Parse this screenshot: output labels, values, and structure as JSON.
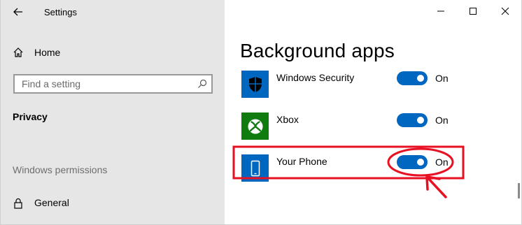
{
  "window": {
    "title": "Settings"
  },
  "sidebar": {
    "home_label": "Home",
    "search_placeholder": "Find a setting",
    "section_privacy": "Privacy",
    "section_permissions": "Windows permissions",
    "general_label": "General"
  },
  "main": {
    "title": "Background apps",
    "apps": [
      {
        "name": "Windows Security",
        "toggle": "On",
        "icon": "shield-icon",
        "icon_bg": "#0067c0"
      },
      {
        "name": "Xbox",
        "toggle": "On",
        "icon": "xbox-icon",
        "icon_bg": "#107c10"
      },
      {
        "name": "Your Phone",
        "toggle": "On",
        "icon": "phone-icon",
        "icon_bg": "#0067c0"
      }
    ]
  },
  "colors": {
    "accent": "#0067c0",
    "sidebar_bg": "#e6e6e6",
    "annotation_red": "#e81123"
  }
}
